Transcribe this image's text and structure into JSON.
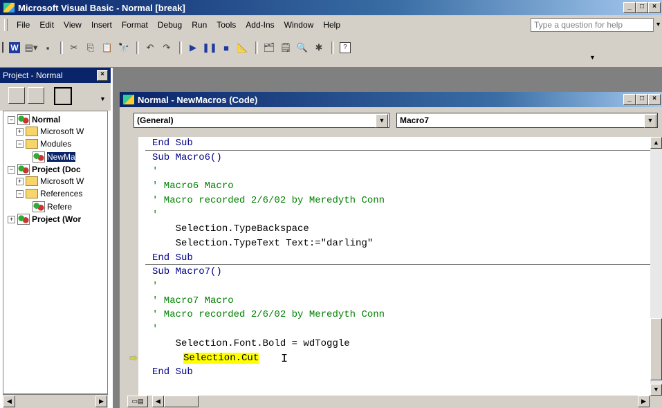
{
  "app": {
    "title": "Microsoft Visual Basic - Normal [break]",
    "window_buttons": [
      "_",
      "□",
      "×"
    ]
  },
  "menu": {
    "items": [
      "File",
      "Edit",
      "View",
      "Insert",
      "Format",
      "Debug",
      "Run",
      "Tools",
      "Add-Ins",
      "Window",
      "Help"
    ],
    "help_placeholder": "Type a question for help"
  },
  "toolbar": {
    "icons": [
      "word-icon",
      "insert-module-icon",
      "save-icon",
      "cut-icon",
      "copy-icon",
      "paste-icon",
      "find-icon",
      "undo-icon",
      "redo-icon",
      "run-icon",
      "break-icon",
      "reset-icon",
      "design-mode-icon",
      "project-explorer-icon",
      "properties-icon",
      "object-browser-icon",
      "toolbox-icon",
      "help-icon"
    ]
  },
  "project_panel": {
    "title": "Project - Normal",
    "tree": [
      {
        "label": "Normal",
        "bold": true,
        "level": 0,
        "toggle": "−",
        "icon": "project"
      },
      {
        "label": "Microsoft W",
        "level": 1,
        "toggle": "+",
        "icon": "folder"
      },
      {
        "label": "Modules",
        "level": 1,
        "toggle": "−",
        "icon": "folder"
      },
      {
        "label": "NewMa",
        "level": 2,
        "toggle": "",
        "icon": "module",
        "selected": true
      },
      {
        "label": "Project (Doc",
        "bold": true,
        "level": 0,
        "toggle": "−",
        "icon": "project"
      },
      {
        "label": "Microsoft W",
        "level": 1,
        "toggle": "+",
        "icon": "folder"
      },
      {
        "label": "References",
        "level": 1,
        "toggle": "−",
        "icon": "folder"
      },
      {
        "label": "Refere",
        "level": 2,
        "toggle": "",
        "icon": "project"
      },
      {
        "label": "Project (Wor",
        "bold": true,
        "level": 0,
        "toggle": "+",
        "icon": "project"
      }
    ]
  },
  "code_window": {
    "title": "Normal - NewMacros (Code)",
    "object_combo": "(General)",
    "proc_combo": "Macro7"
  },
  "code": {
    "lines": [
      {
        "text": "End Sub",
        "type": "kw"
      },
      {
        "text": "Sub Macro6()",
        "type": "kw"
      },
      {
        "text": "'",
        "type": "cm"
      },
      {
        "text": "' Macro6 Macro",
        "type": "cm"
      },
      {
        "text": "' Macro recorded 2/6/02 by Meredyth Conn",
        "type": "cm"
      },
      {
        "text": "'",
        "type": "cm"
      },
      {
        "text": "    Selection.TypeBackspace",
        "type": "code"
      },
      {
        "text": "    Selection.TypeText Text:=\"darling\"",
        "type": "code"
      },
      {
        "text": "End Sub",
        "type": "kw"
      },
      {
        "text": "Sub Macro7()",
        "type": "kw"
      },
      {
        "text": "'",
        "type": "cm"
      },
      {
        "text": "' Macro7 Macro",
        "type": "cm"
      },
      {
        "text": "' Macro recorded 2/6/02 by Meredyth Conn",
        "type": "cm"
      },
      {
        "text": "'",
        "type": "cm"
      },
      {
        "text": "    Selection.Font.Bold = wdToggle",
        "type": "code"
      },
      {
        "text": "Selection.Cut",
        "type": "highlight"
      },
      {
        "text": "End Sub",
        "type": "kw"
      }
    ]
  }
}
